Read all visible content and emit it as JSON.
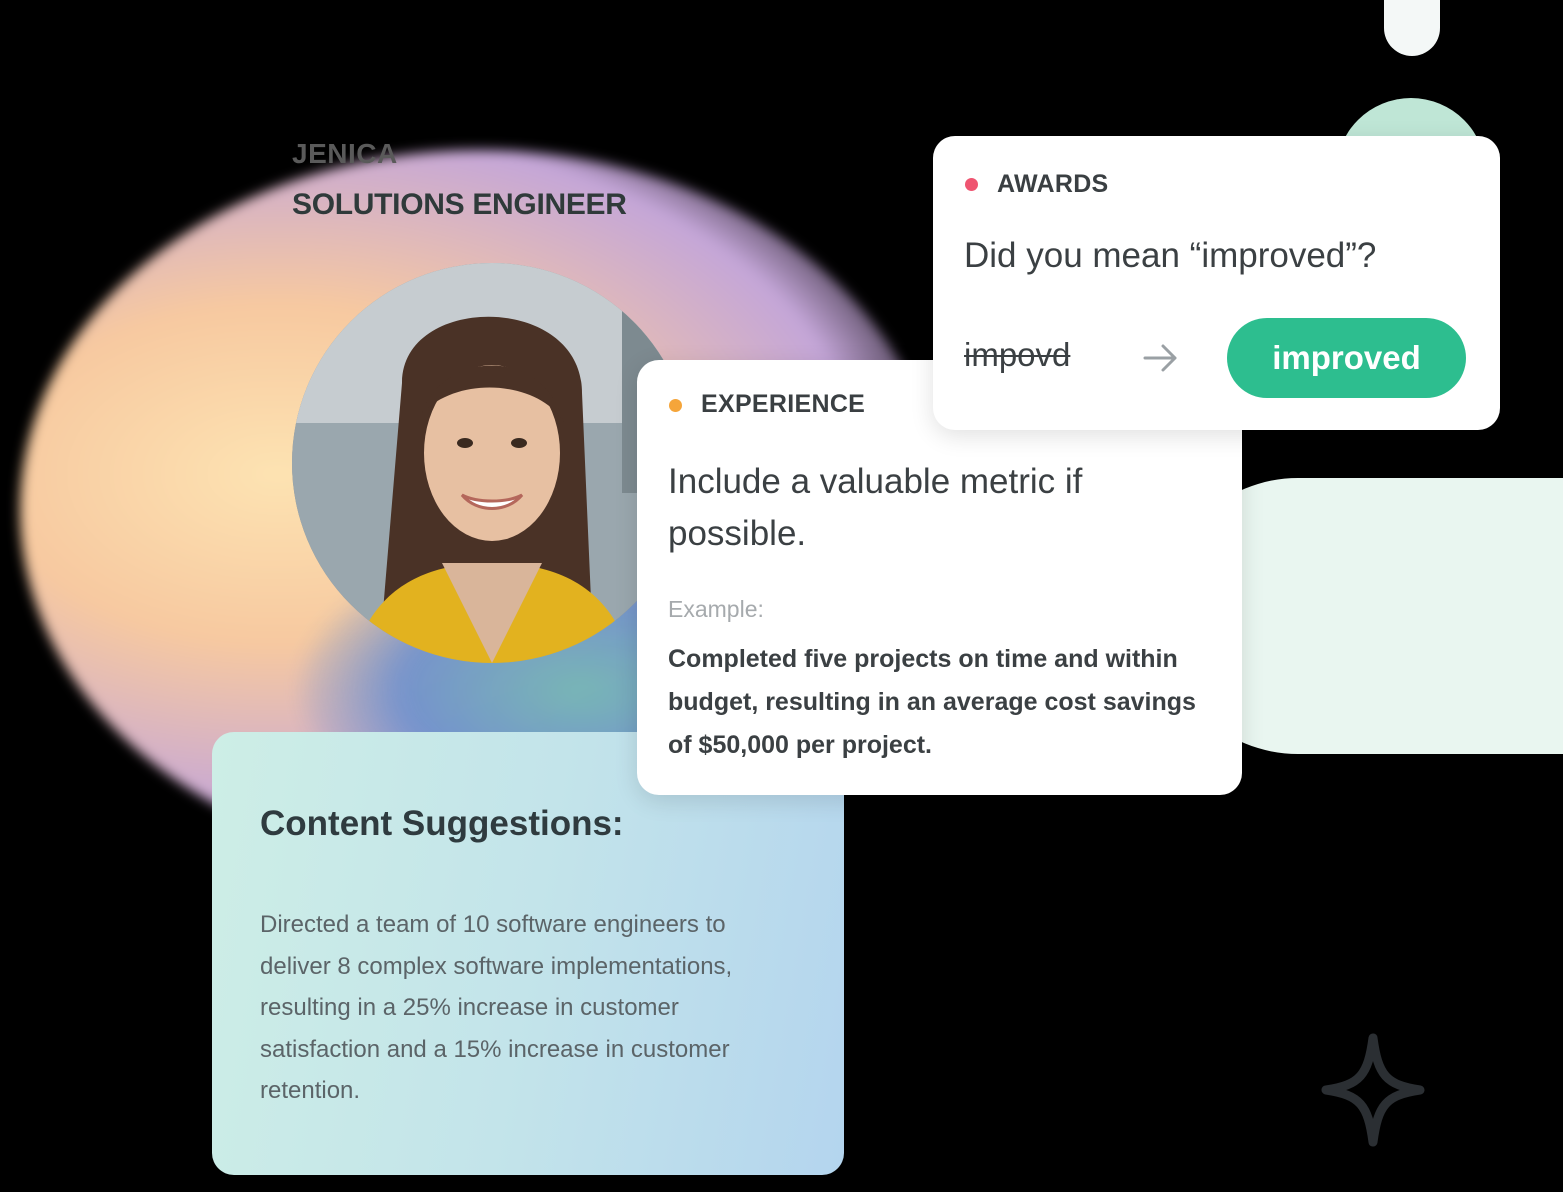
{
  "profile": {
    "first_name": "JENICA",
    "role": "SOLUTIONS ENGINEER"
  },
  "content_suggestions": {
    "title": "Content Suggestions:",
    "body": "Directed a team of 10 software engineers to deliver 8 complex software implementations, resulting in a 25% increase in customer satisfaction and a 15% increase in customer retention."
  },
  "experience": {
    "label": "EXPERIENCE",
    "tip": "Include a valuable metric if possible.",
    "example_label": "Example:",
    "example": "Completed five projects on time and within budget, resulting in an average cost savings of $50,000 per project."
  },
  "awards": {
    "label": "AWARDS",
    "question": "Did you mean “improved”?",
    "misspelled": "impovd",
    "suggestion": "improved"
  },
  "colors": {
    "accent_green": "#2dbe8f",
    "awards_dot": "#ef5571",
    "experience_dot": "#f5a53a",
    "mint": "#e9f6f0"
  },
  "icons": [
    "arrow-right-icon",
    "sparkle-star-icon"
  ]
}
